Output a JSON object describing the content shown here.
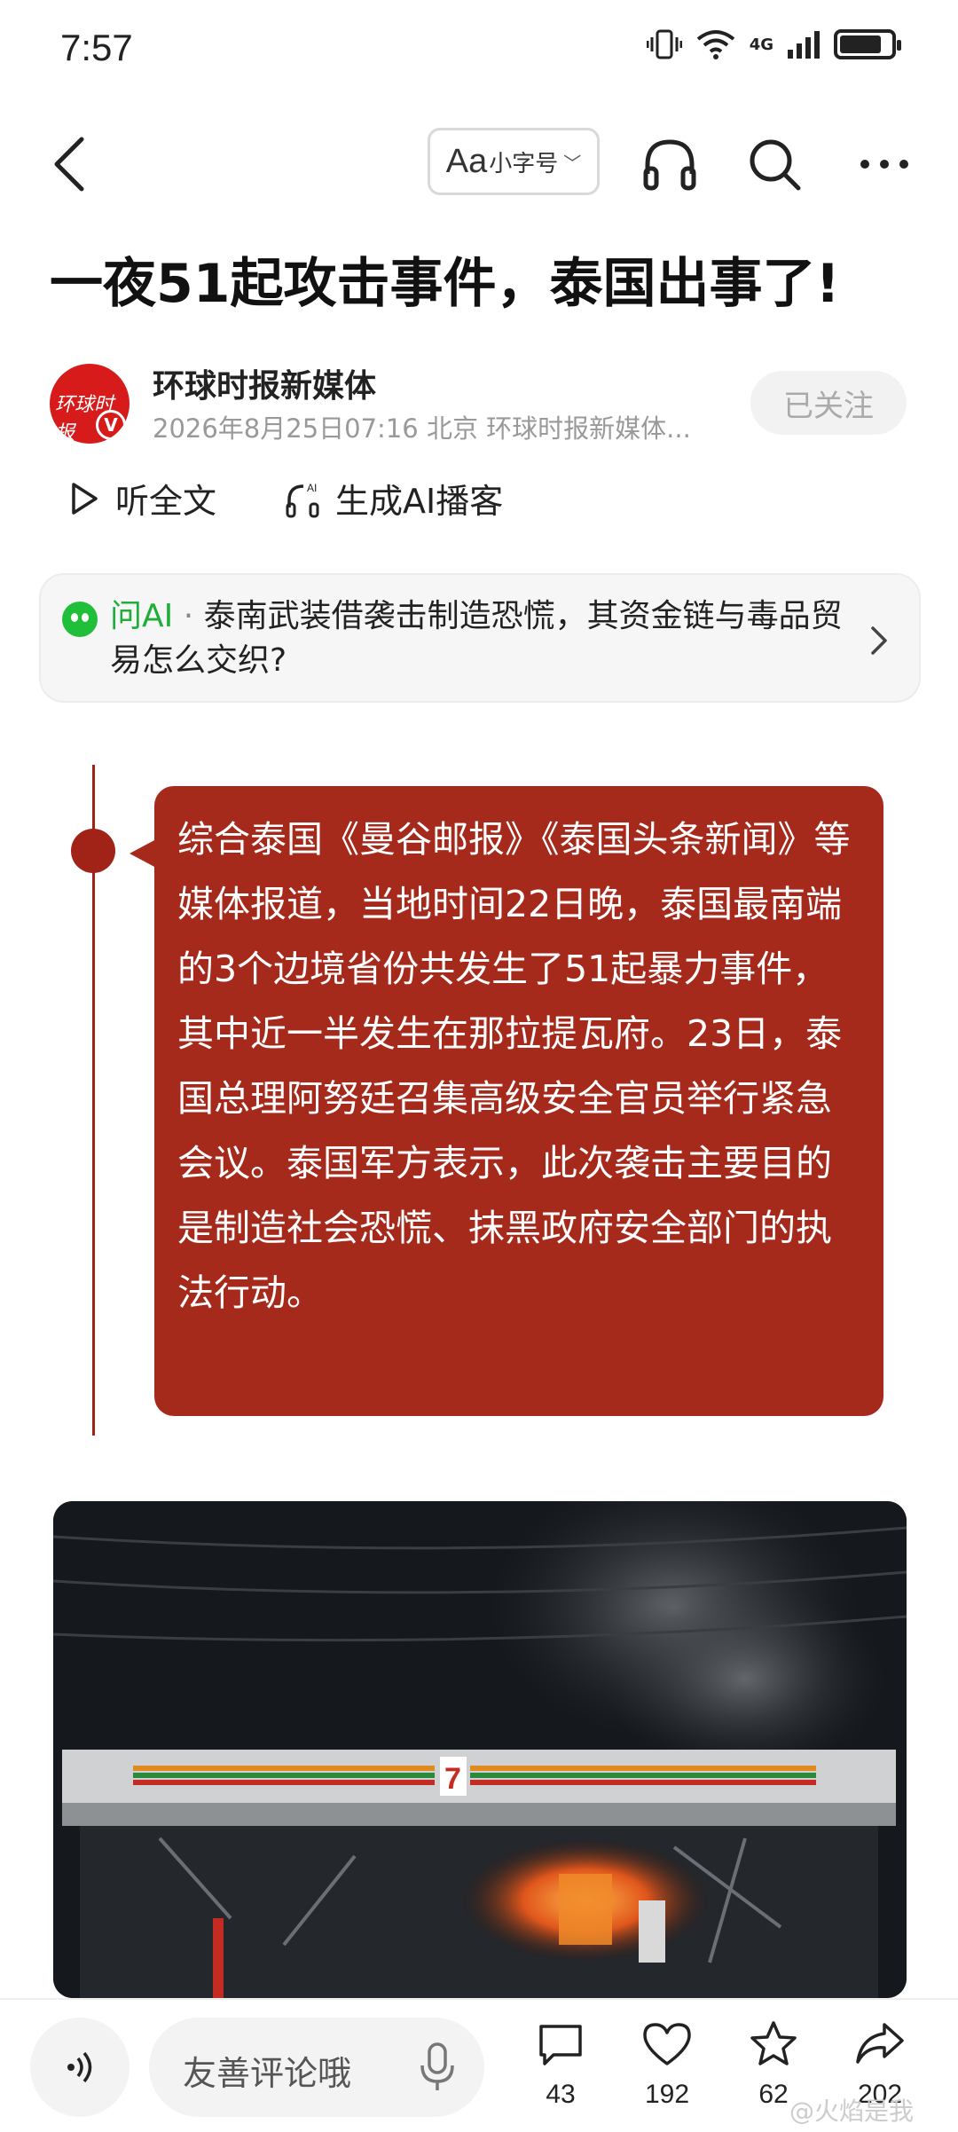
{
  "status_bar": {
    "time": "7:57",
    "network": "4G",
    "signal_badge": "6"
  },
  "nav": {
    "font_size_label_aa": "Aa",
    "font_size_label": "小字号",
    "icons": [
      "back-icon",
      "headphones-icon",
      "search-icon",
      "more-icon"
    ]
  },
  "article": {
    "title": "一夜51起攻击事件，泰国出事了!"
  },
  "author": {
    "avatar_text": "环球时报",
    "name": "环球时报新媒体",
    "meta": "2026年8月25日07:16 北京 环球时报新媒体...",
    "follow_label": "已关注"
  },
  "actions": {
    "listen_label": "听全文",
    "podcast_label": "生成AI播客",
    "podcast_badge": "AI"
  },
  "ask_ai": {
    "label": "问AI",
    "separator": " · ",
    "question": "泰南武装借袭击制造恐慌，其资金链与毒品贸易怎么交织?"
  },
  "quote": {
    "text": "综合泰国《曼谷邮报》《泰国头条新闻》等媒体报道，当地时间22日晚，泰国最南端的3个边境省份共发生了51起暴力事件，其中近一半发生在那拉提瓦府。23日，泰国总理阿努廷召集高级安全官员举行紧急会议。泰国军方表示，此次袭击主要目的是制造社会恐慌、抹黑政府安全部门的执法行动。"
  },
  "photo": {
    "store_sign": "7"
  },
  "bottom_bar": {
    "comment_placeholder": "友善评论哦",
    "comments": "43",
    "likes": "192",
    "favorites": "62",
    "shares": "202",
    "watermark": "@火焰是我"
  },
  "colors": {
    "accent_red": "#a62a1c",
    "ai_green": "#1fae3a",
    "brand_red": "#d71a1a"
  }
}
